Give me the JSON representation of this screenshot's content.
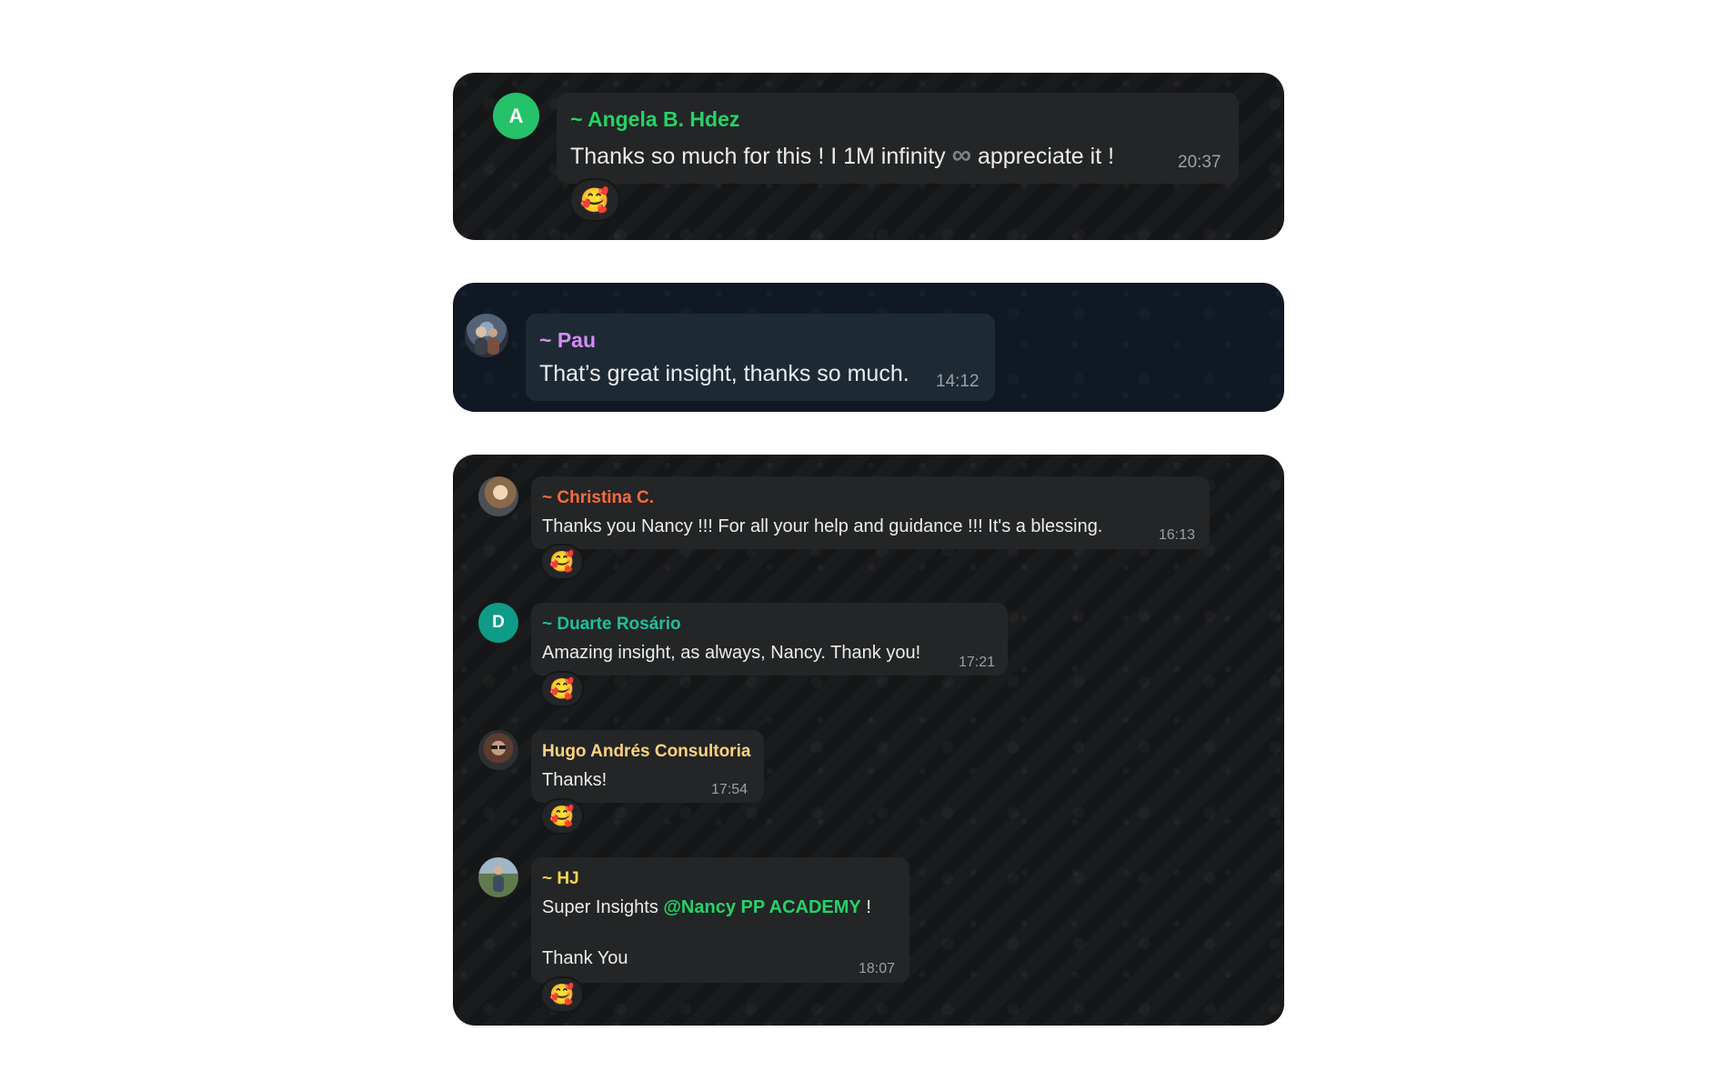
{
  "colors": {
    "angela_name": "#25d366",
    "pau_name": "#d68cf5",
    "christina_name": "#ff6b3d",
    "duarte_name": "#1fbf9f",
    "hugo_name": "#ffd37a",
    "hj_name": "#ffd54a",
    "mention": "#25d366",
    "angela_avatar": "#25c26a",
    "duarte_avatar": "#109a88"
  },
  "panel1": {
    "avatar_letter": "A",
    "sender": "~ Angela B. Hdez",
    "message_before": "Thanks so much for this ! I 1M infinity",
    "infinity_glyph": "∞",
    "message_after": "appreciate it !",
    "time": "20:37",
    "reaction": "🥰"
  },
  "panel2": {
    "sender": "~ Pau",
    "message": "That’s great insight, thanks so much.",
    "time": "14:12"
  },
  "panel3": {
    "messages": [
      {
        "sender": "~ Christina C.",
        "message": "Thanks you Nancy !!! For all your help and guidance !!! It's a blessing.",
        "time": "16:13",
        "reaction": "🥰"
      },
      {
        "avatar_letter": "D",
        "sender": "~ Duarte Rosário",
        "message": "Amazing insight, as always, Nancy. Thank you!",
        "time": "17:21",
        "reaction": "🥰"
      },
      {
        "sender": "Hugo Andrés Consultoria",
        "message": "Thanks!",
        "time": "17:54",
        "reaction": "🥰"
      },
      {
        "sender": "~ HJ",
        "message_before": "Super Insights",
        "mention": "@Nancy PP ACADEMY",
        "message_after": "!",
        "message_line2": "Thank You",
        "time": "18:07",
        "reaction": "🥰"
      }
    ]
  }
}
